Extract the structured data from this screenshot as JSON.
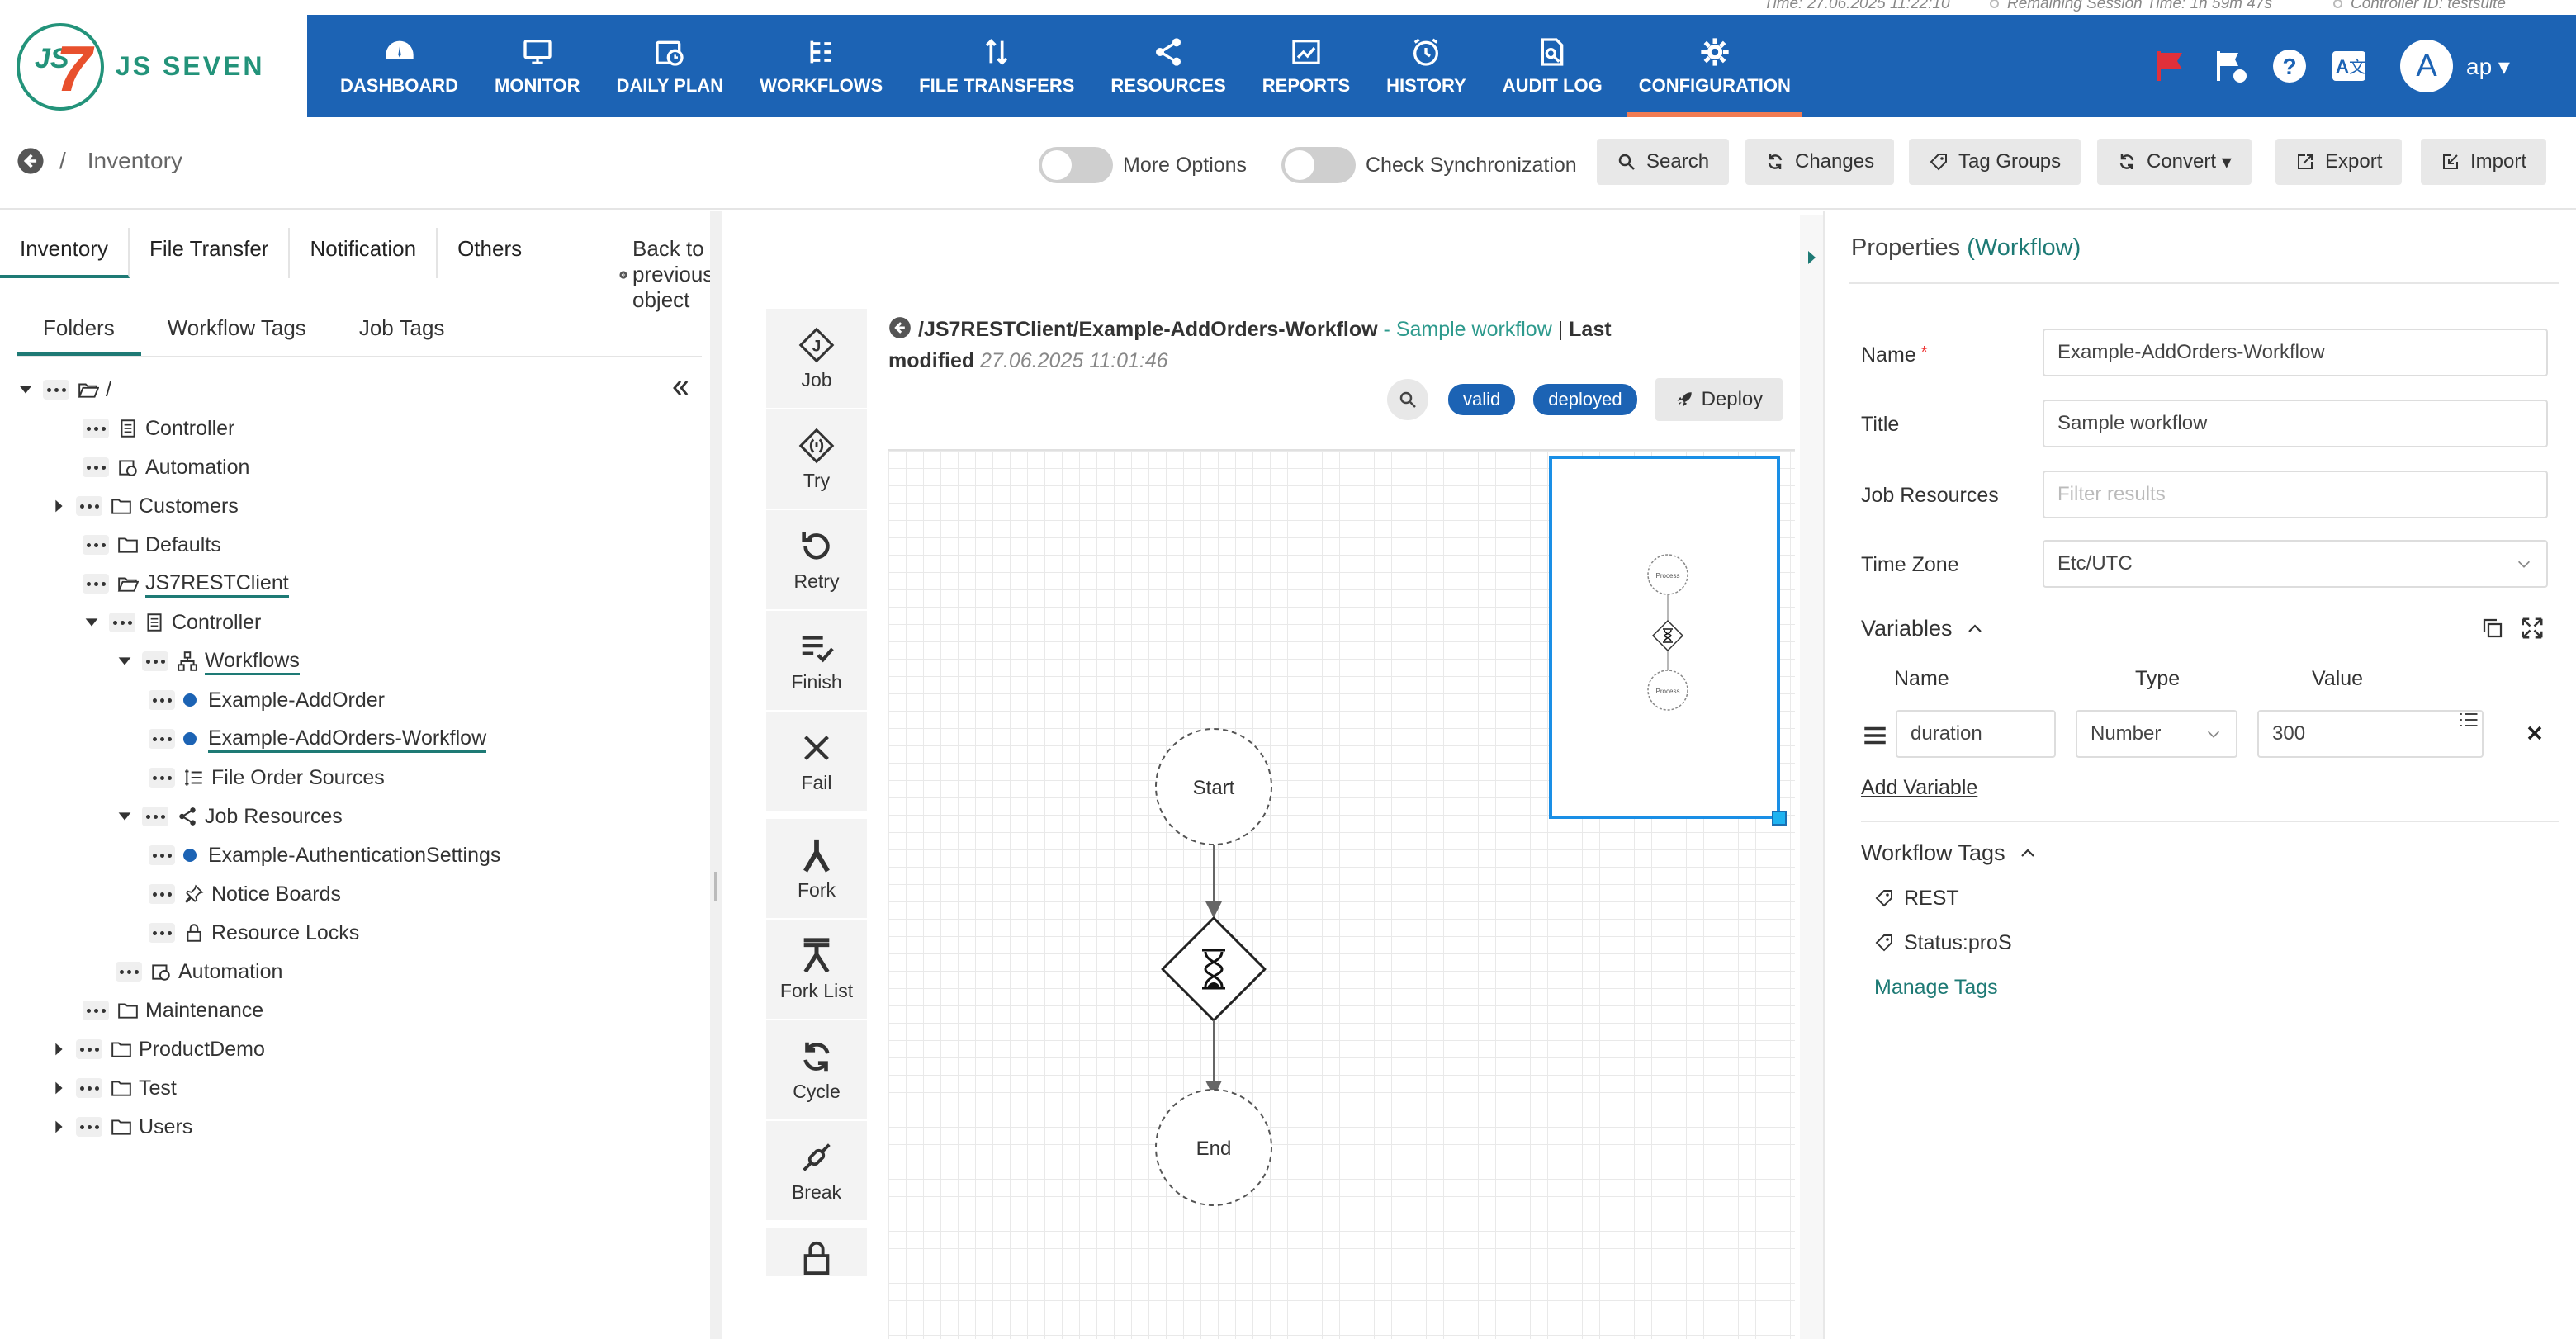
{
  "status": {
    "time": "Time: 27.06.2025 11:22:10",
    "session": "Remaining Session Time: 1h 59m 47s",
    "controller": "Controller ID: testsuite"
  },
  "brand": {
    "name": "JS SEVEN",
    "accent": "#1c63b4",
    "teal": "#1e7a75"
  },
  "nav": [
    {
      "label": "DASHBOARD",
      "icon": "dashboard-icon"
    },
    {
      "label": "MONITOR",
      "icon": "monitor-icon"
    },
    {
      "label": "DAILY PLAN",
      "icon": "daily-plan-icon"
    },
    {
      "label": "WORKFLOWS",
      "icon": "workflows-icon"
    },
    {
      "label": "FILE TRANSFERS",
      "icon": "file-transfers-icon"
    },
    {
      "label": "RESOURCES",
      "icon": "resources-icon"
    },
    {
      "label": "REPORTS",
      "icon": "reports-icon"
    },
    {
      "label": "HISTORY",
      "icon": "history-icon"
    },
    {
      "label": "AUDIT LOG",
      "icon": "audit-log-icon"
    },
    {
      "label": "CONFIGURATION",
      "icon": "configuration-icon"
    }
  ],
  "user": {
    "initial": "A",
    "name": "ap"
  },
  "toolbar": {
    "breadcrumb": "Inventory",
    "slash": "/",
    "more_options": "More Options",
    "check_sync": "Check Synchronization",
    "search": "Search",
    "changes": "Changes",
    "tag_groups": "Tag Groups",
    "convert": "Convert",
    "export": "Export",
    "import": "Import"
  },
  "left": {
    "tabs": [
      "Inventory",
      "File Transfer",
      "Notification",
      "Others"
    ],
    "back": "Back to previous object",
    "subtabs": [
      "Folders",
      "Workflow Tags",
      "Job Tags"
    ],
    "tree": [
      "/",
      "Controller",
      "Automation",
      "Customers",
      "Defaults",
      "JS7RESTClient",
      "Controller",
      "Workflows",
      "Example-AddOrder",
      "Example-AddOrders-Workflow",
      "File Order Sources",
      "Job Resources",
      "Example-AuthenticationSettings",
      "Notice Boards",
      "Resource Locks",
      "Automation",
      "Maintenance",
      "ProductDemo",
      "Test",
      "Users"
    ]
  },
  "palette": [
    "Job",
    "Try",
    "Retry",
    "Finish",
    "Fail",
    "Fork",
    "Fork List",
    "Cycle",
    "Break"
  ],
  "workflow": {
    "path": "/JS7RESTClient/Example-AddOrders-Workflow",
    "sep": " - ",
    "subtitle": "Sample workflow",
    "pipe": " | ",
    "last_modified_label": "Last modified",
    "last_modified": "27.06.2025 11:01:46",
    "badge_valid": "valid",
    "badge_deployed": "deployed",
    "deploy": "Deploy",
    "start": "Start",
    "end": "End",
    "mini_process": "Process"
  },
  "props": {
    "title": "Properties",
    "type": "(Workflow)",
    "name_label": "Name",
    "name_required": "*",
    "name_value": "Example-AddOrders-Workflow",
    "title_label": "Title",
    "title_value": "Sample workflow",
    "jobres_label": "Job Resources",
    "jobres_placeholder": "Filter results",
    "tz_label": "Time Zone",
    "tz_value": "Etc/UTC",
    "variables_label": "Variables",
    "col_name": "Name",
    "col_type": "Type",
    "col_value": "Value",
    "var_name": "duration",
    "var_type": "Number",
    "var_value": "300",
    "add_variable": "Add Variable",
    "tags_label": "Workflow Tags",
    "tags": [
      "REST",
      "Status:proS"
    ],
    "manage_tags": "Manage Tags"
  }
}
